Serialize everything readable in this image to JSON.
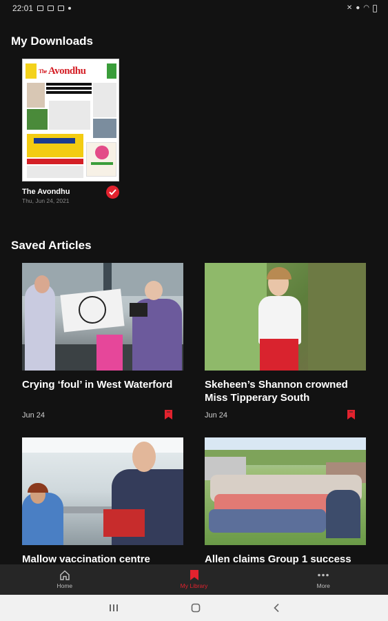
{
  "status_bar": {
    "time": "22:01"
  },
  "downloads": {
    "heading": "My Downloads",
    "items": [
      {
        "title": "The Avondhu",
        "date": "Thu, Jun 24, 2021",
        "masthead_the": "The",
        "masthead_name": "Avondhu",
        "downloaded": true
      }
    ]
  },
  "saved": {
    "heading": "Saved Articles",
    "articles": [
      {
        "title": "Crying ‘foul’ in West Waterford",
        "date": "Jun 24",
        "saved": true
      },
      {
        "title": "Skeheen’s Shannon crowned Miss Tipperary South",
        "date": "Jun 24",
        "saved": true
      },
      {
        "title": "Mallow vaccination centre",
        "date": "",
        "saved": true
      },
      {
        "title": "Allen claims Group 1 success",
        "date": "",
        "saved": true
      }
    ]
  },
  "bottom_nav": {
    "items": [
      {
        "label": "Home",
        "icon": "home-icon",
        "active": false
      },
      {
        "label": "My Library",
        "icon": "bookmark-icon",
        "active": true
      },
      {
        "label": "More",
        "icon": "more-icon",
        "active": false
      }
    ]
  },
  "colors": {
    "accent": "#e2222e",
    "background": "#121212",
    "nav_background": "#262626"
  }
}
